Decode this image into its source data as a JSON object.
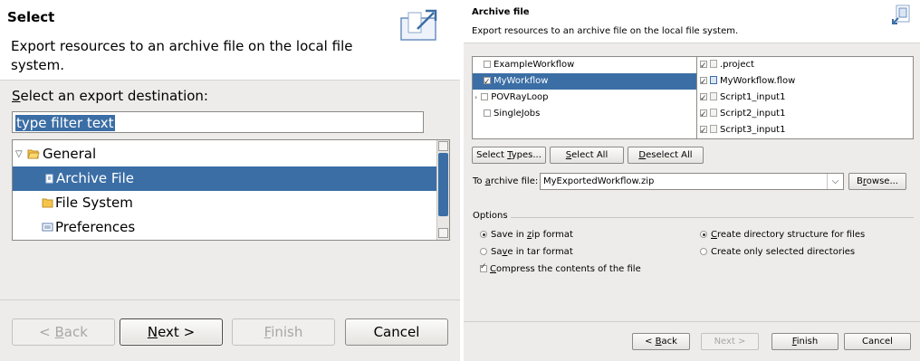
{
  "left": {
    "title": "Select",
    "description": "Export resources to an archive file on the local file system.",
    "destination_label_prefix": "S",
    "destination_label_rest": "elect an export destination:",
    "filter_placeholder": "type filter text",
    "tree": [
      {
        "label": "General",
        "icon": "folder-open-icon",
        "expanded": true
      },
      {
        "label": "Archive File",
        "icon": "archive-file-icon",
        "selected": true
      },
      {
        "label": "File System",
        "icon": "folder-icon"
      },
      {
        "label": "Preferences",
        "icon": "preferences-icon"
      }
    ],
    "buttons": {
      "back": {
        "pre": "< ",
        "mnemonic": "B",
        "rest": "ack"
      },
      "next": {
        "pre": "",
        "mnemonic": "N",
        "rest": "ext >"
      },
      "finish": {
        "pre": "",
        "mnemonic": "F",
        "rest": "inish"
      },
      "cancel": "Cancel"
    }
  },
  "right": {
    "title": "Archive file",
    "description": "Export resources to an archive file on the local file system.",
    "projects": [
      {
        "label": "ExampleWorkflow",
        "checked": false,
        "expandable": false
      },
      {
        "label": "MyWorkflow",
        "checked": true,
        "selected": true,
        "expandable": false
      },
      {
        "label": "POVRayLoop",
        "checked": false,
        "expandable": true
      },
      {
        "label": "SingleJobs",
        "checked": false,
        "expandable": false
      }
    ],
    "files": [
      {
        "label": ".project",
        "checked": true,
        "icon": "file-icon"
      },
      {
        "label": "MyWorkflow.flow",
        "checked": true,
        "icon": "flow-file-icon"
      },
      {
        "label": "Script1_input1",
        "checked": true,
        "icon": "file-icon"
      },
      {
        "label": "Script2_input1",
        "checked": true,
        "icon": "file-icon"
      },
      {
        "label": "Script3_input1",
        "checked": true,
        "icon": "file-icon"
      }
    ],
    "select_types": {
      "pre": "Select ",
      "mnemonic": "T",
      "rest": "ypes..."
    },
    "select_all": {
      "pre": "",
      "mnemonic": "S",
      "rest": "elect All"
    },
    "deselect_all": {
      "pre": "",
      "mnemonic": "D",
      "rest": "eselect All"
    },
    "archive_label": {
      "pre": "To ",
      "mnemonic": "a",
      "rest": "rchive file:"
    },
    "archive_value": "MyExportedWorkflow.zip",
    "browse": {
      "pre": "B",
      "mnemonic": "r",
      "rest": "owse..."
    },
    "options_label": "Options",
    "options": {
      "zip": {
        "pre": "Save in ",
        "mnemonic": "z",
        "rest": "ip format",
        "checked": true
      },
      "tar": {
        "pre": "Sa",
        "mnemonic": "v",
        "rest": "e in tar format",
        "checked": false
      },
      "compress": {
        "pre": "",
        "mnemonic": "C",
        "rest": "ompress the contents of the file",
        "checked": true
      },
      "create_dirs": {
        "pre": "",
        "mnemonic": "C",
        "rest": "reate directory structure for files",
        "checked": true
      },
      "only_selected": {
        "pre": "Create only selected directories",
        "mnemonic": "",
        "rest": "",
        "checked": false
      }
    },
    "buttons": {
      "back": {
        "pre": "< ",
        "mnemonic": "B",
        "rest": "ack"
      },
      "next": "Next >",
      "finish": {
        "pre": "",
        "mnemonic": "F",
        "rest": "inish"
      },
      "cancel": "Cancel"
    }
  }
}
